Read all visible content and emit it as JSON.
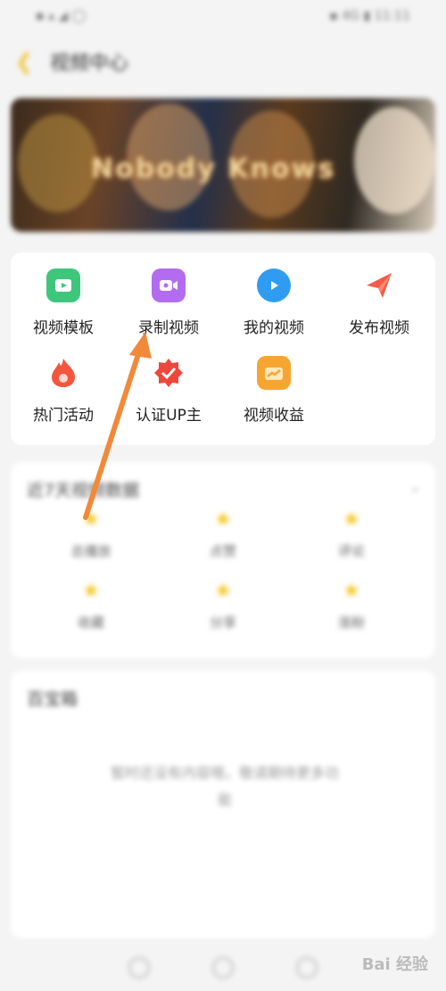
{
  "status_bar": {
    "left": "▪ ▴ ◢ ◯",
    "right": "▪ 4G ▮ 11:11"
  },
  "header": {
    "title": "视频中心"
  },
  "banner": {
    "text": "Nobody Knows"
  },
  "tools": [
    {
      "label": "视频模板",
      "icon": "video-template-icon",
      "color": "#3ec77b"
    },
    {
      "label": "录制视频",
      "icon": "record-video-icon",
      "color": "#b36cf0"
    },
    {
      "label": "我的视频",
      "icon": "my-video-icon",
      "color": "#2f9cf2"
    },
    {
      "label": "发布视频",
      "icon": "publish-video-icon",
      "color": "#f55a4a"
    },
    {
      "label": "热门活动",
      "icon": "hot-activity-icon",
      "color": "#f4553e"
    },
    {
      "label": "认证UP主",
      "icon": "verified-up-icon",
      "color": "#f0473c"
    },
    {
      "label": "视频收益",
      "icon": "video-earnings-icon",
      "color": "#f7a531"
    }
  ],
  "data_section": {
    "title": "近7天视频数据",
    "stats": [
      "总播放",
      "点赞",
      "评论",
      "收藏",
      "分享",
      "涨粉"
    ]
  },
  "box_section": {
    "title": "百宝箱",
    "empty": "暂时还没有内容哦，敬请期待更多功能"
  },
  "watermark": {
    "text": "Bai 经验"
  }
}
